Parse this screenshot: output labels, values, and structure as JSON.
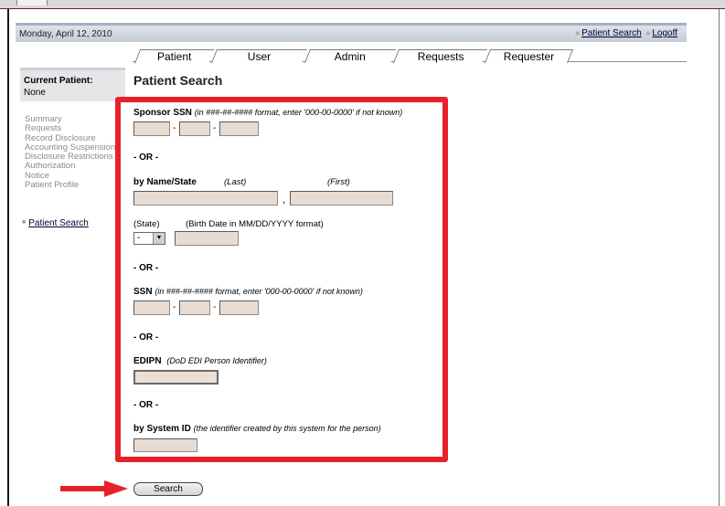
{
  "header": {
    "date": "Monday, April 12, 2010",
    "links": [
      "Patient Search",
      "Logoff"
    ]
  },
  "tabs": [
    {
      "label": "Patient",
      "active": true
    },
    {
      "label": "User",
      "active": false
    },
    {
      "label": "Admin",
      "active": false
    },
    {
      "label": "Requests",
      "active": false
    },
    {
      "label": "Requester",
      "active": false
    }
  ],
  "sidebar": {
    "current_patient_label": "Current Patient:",
    "current_patient_value": "None",
    "nav_items": [
      "Summary",
      "Requests",
      "Record Disclosure",
      "Accounting Suspension",
      "Disclosure Restrictions",
      "Authorization",
      "Notice",
      "Patient Profile"
    ],
    "link": "Patient Search"
  },
  "page_title": "Patient Search",
  "form": {
    "sponsor_ssn_label": "Sponsor SSN",
    "sponsor_ssn_note": "(in ###-##-#### format, enter '000-00-0000' if not known)",
    "or_text": "- OR -",
    "by_name_label": "by Name/State",
    "last_label": "(Last)",
    "first_label": "(First)",
    "comma": ",",
    "state_label": "(State)",
    "birth_label": "(Birth Date in MM/DD/YYYY format)",
    "state_value": "-",
    "ssn_label": "SSN",
    "ssn_note": "(in ###-##-#### format, enter '000-00-0000' if not known)",
    "edipn_label": "EDIPN",
    "edipn_note": "(DoD EDI Person Identifier)",
    "system_id_label": "by System ID",
    "system_id_note": "(the identifier created by this system for the person)",
    "dash": "-"
  },
  "search_button": "Search",
  "colors": {
    "highlight": "#e8202a",
    "input_bg": "#e8dcd2",
    "header_bg": "#c6ccd6"
  }
}
